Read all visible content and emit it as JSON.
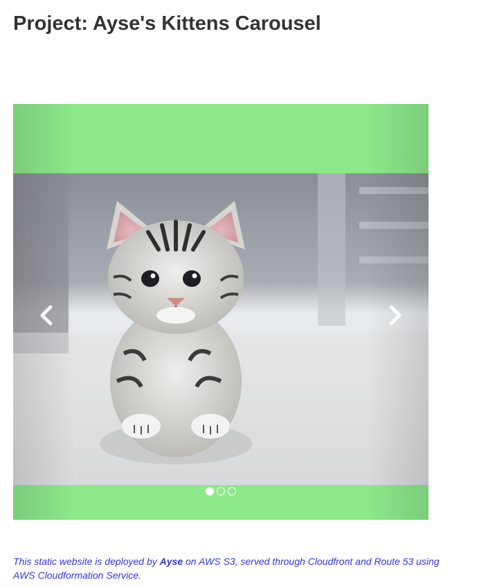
{
  "header": {
    "title": "Project: Ayse's Kittens Carousel"
  },
  "carousel": {
    "background_color": "#8ce98a",
    "active_slide": 1,
    "slide_count": 3,
    "image_subject": "tabby kitten sitting on floor",
    "controls": {
      "prev_icon": "chevron-left-icon",
      "next_icon": "chevron-right-icon"
    }
  },
  "footer": {
    "text_before": "This static website is deployed by ",
    "author": "Ayse",
    "text_after": " on AWS S3, served through Cloudfront and Route 53 using AWS Cloudformation Service.",
    "color": "#3333dd"
  }
}
